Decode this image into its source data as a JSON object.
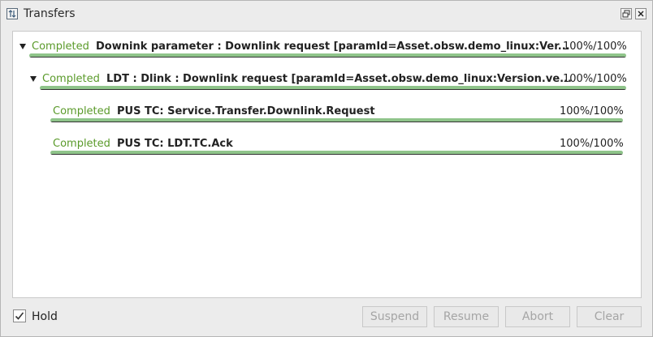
{
  "window": {
    "title": "Transfers",
    "restore_icon": "restore-icon",
    "close_icon": "close-icon"
  },
  "transfers": [
    {
      "status": "Completed",
      "name": "Downink parameter : Downlink request [paramId=Asset.obsw.demo_linux:Ver...",
      "progress_text": "100%/100%",
      "progress": 1.0,
      "level": 0,
      "expanded": true
    },
    {
      "status": "Completed",
      "name": "LDT : Dlink : Downlink request [paramId=Asset.obsw.demo_linux:Version.ve...",
      "progress_text": "100%/100%",
      "progress": 1.0,
      "level": 1,
      "expanded": true
    },
    {
      "status": "Completed",
      "name": "PUS TC: Service.Transfer.Downlink.Request",
      "progress_text": "100%/100%",
      "progress": 1.0,
      "level": 2
    },
    {
      "status": "Completed",
      "name": "PUS TC: LDT.TC.Ack",
      "progress_text": "100%/100%",
      "progress": 1.0,
      "level": 2
    }
  ],
  "footer": {
    "hold_label": "Hold",
    "hold_checked": true,
    "buttons": {
      "suspend": "Suspend",
      "resume": "Resume",
      "abort": "Abort",
      "clear": "Clear"
    }
  },
  "colors": {
    "status_green": "#5a9a2a",
    "bar_fill": "#8fc48a"
  }
}
